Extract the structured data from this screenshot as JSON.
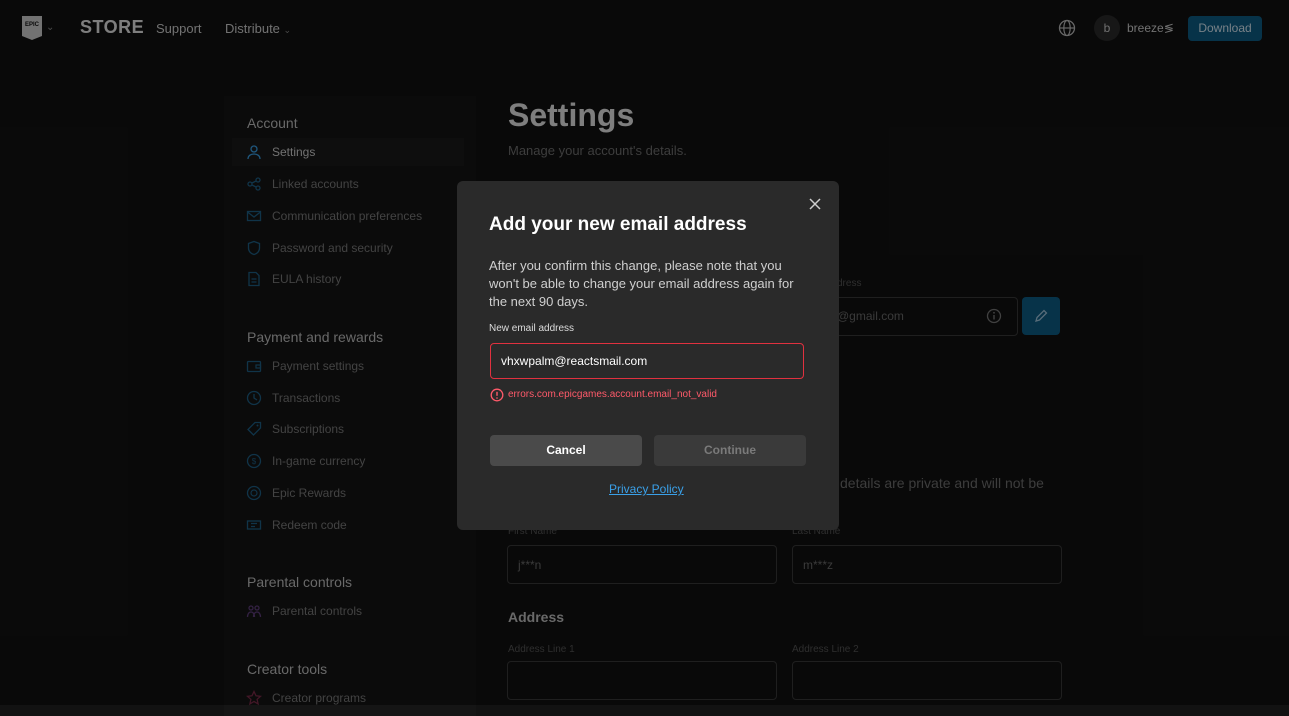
{
  "nav": {
    "store": "STORE",
    "support": "Support",
    "distribute": "Distribute",
    "avatar_initial": "b",
    "username": "breeze",
    "download": "Download"
  },
  "sidebar": {
    "groups": [
      {
        "title": "Account",
        "items": [
          "Settings",
          "Linked accounts",
          "Communication preferences",
          "Password and security",
          "EULA history"
        ]
      },
      {
        "title": "Payment and rewards",
        "items": [
          "Payment settings",
          "Transactions",
          "Subscriptions",
          "In-game currency",
          "Epic Rewards",
          "Redeem code"
        ]
      },
      {
        "title": "Parental controls",
        "items": [
          "Parental controls"
        ]
      },
      {
        "title": "Creator tools",
        "items": [
          "Creator programs"
        ]
      }
    ]
  },
  "page": {
    "title": "Settings",
    "subtitle": "Manage your account's details.",
    "email_label": "dress",
    "email_value": "@gmail.com",
    "privacy_note": "details are private and will not be",
    "first_name_label": "First Name",
    "first_name": "j***n",
    "last_name_label": "Last Name",
    "last_name": "m***z",
    "address_title": "Address",
    "address_line1_label": "Address Line 1",
    "address_line2_label": "Address Line 2"
  },
  "modal": {
    "title": "Add your new email address",
    "description": "After you confirm this change, please note that you won't be able to change your email address again for the next 90 days.",
    "input_label": "New email address",
    "input_value": "vhxwpalm@reactsmail.com",
    "error": "errors.com.epicgames.account.email_not_valid",
    "cancel": "Cancel",
    "continue": "Continue",
    "privacy": "Privacy Policy"
  },
  "colors": {
    "accent": "#0d5d86",
    "error": "#e0313f",
    "link": "#3aa0e8"
  }
}
